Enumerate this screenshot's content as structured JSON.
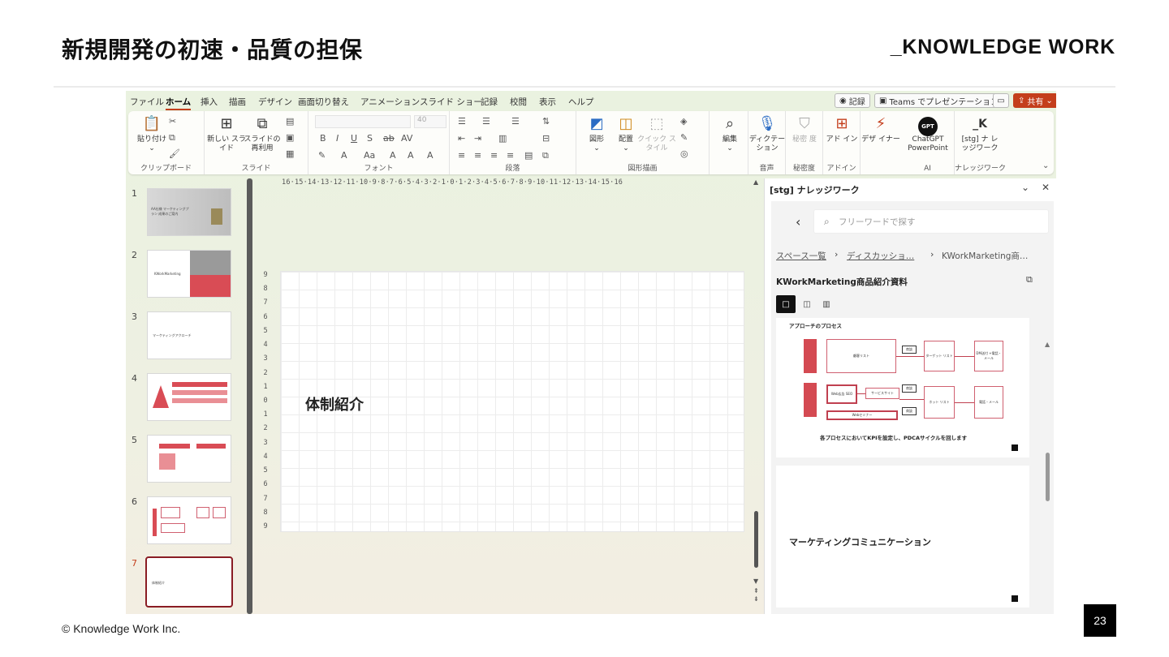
{
  "slide": {
    "title": "新規開発の初速・品質の担保",
    "brand": "_KNOWLEDGE WORK",
    "footer": "© Knowledge Work Inc.",
    "page_number": "23"
  },
  "ppt": {
    "tabs": [
      "ファイル",
      "ホーム",
      "挿入",
      "描画",
      "デザイン",
      "画面切り替え",
      "アニメーション",
      "スライド ショー",
      "記録",
      "校閲",
      "表示",
      "ヘルプ"
    ],
    "active_tab": "ホーム",
    "top_buttons": {
      "record": "記録",
      "teams": "Teams でプレゼンテーション",
      "share": "共有"
    },
    "ribbon": {
      "clipboard": {
        "paste": "貼り付け",
        "label": "クリップボード"
      },
      "slides": {
        "new": "新しい スライド",
        "reuse": "スライドの 再利用",
        "label": "スライド"
      },
      "font": {
        "size": "40",
        "label": "フォント"
      },
      "paragraph": {
        "label": "段落"
      },
      "drawing": {
        "shapes": "図形",
        "arrange": "配置",
        "quick_styles": "クイック スタイル",
        "label": "図形描画"
      },
      "editing": {
        "edit": "編集"
      },
      "voice": {
        "dictate": "ディクテー ション",
        "label": "音声"
      },
      "sensitivity": {
        "btn": "秘密 度",
        "label": "秘密度"
      },
      "addins": {
        "btn": "アド イン",
        "label": "アドイン"
      },
      "designer": {
        "btn": "デザ イナー"
      },
      "ai": {
        "chatgpt": "ChatGPT PowerPoint",
        "label": "AI"
      },
      "knowledge": {
        "btn": "[stg] ナ レッジワーク",
        "label": "ナレッジワーク"
      }
    },
    "thumbnails": [
      {
        "num": "1",
        "caption": "AA社様 マーケティングプラン 成果のご案内"
      },
      {
        "num": "2",
        "caption": "KWorkMarketing"
      },
      {
        "num": "3",
        "caption": "マーケティングアクローチ"
      },
      {
        "num": "4",
        "caption": ""
      },
      {
        "num": "5",
        "caption": ""
      },
      {
        "num": "6",
        "caption": ""
      },
      {
        "num": "7",
        "caption": "体制紹介"
      }
    ],
    "ruler_h": "16·15·14·13·12·11·10·9·8·7·6·5·4·3·2·1·0·1·2·3·4·5·6·7·8·9·10·11·12·13·14·15·16",
    "ruler_v": [
      "9",
      "8",
      "7",
      "6",
      "5",
      "4",
      "3",
      "2",
      "1",
      "0",
      "1",
      "2",
      "3",
      "4",
      "5",
      "6",
      "7",
      "8",
      "9"
    ],
    "slide_text": "体制紹介",
    "pane": {
      "title": "[stg] ナレッジワーク",
      "search_placeholder": "フリーワードで探す",
      "breadcrumbs": [
        "スペース一覧",
        "ディスカッショ…",
        "KWorkMarketing商…"
      ],
      "doc_title": "KWorkMarketing商品紹介資料",
      "card1": {
        "heading": "アプローチのプロセス",
        "boxes": {
          "list": "顧客リスト",
          "tag1": "商談",
          "target": "ターゲット リスト",
          "dm": "DM送付 +電話・メール",
          "web": "Web広告 SEO",
          "service": "サービスサイト",
          "tag2": "商談",
          "hot": "ホット リスト",
          "call": "電話・メール",
          "tag3": "商談",
          "seminar": "Webセミナー"
        },
        "caption": "各プロセスにおいてKPIを設定し、PDCAサイクルを回します"
      },
      "card2": {
        "heading": "マーケティングコミュニケーション"
      }
    }
  }
}
